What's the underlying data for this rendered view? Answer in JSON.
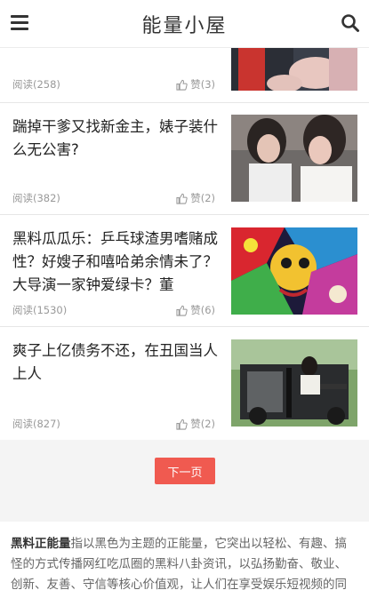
{
  "header": {
    "title": "能量小屋",
    "menu_icon": "hamburger-menu-icon",
    "search_icon": "search-icon"
  },
  "articles": [
    {
      "title": "",
      "reads": "阅读(258)",
      "likes": "赞(3)"
    },
    {
      "title": "踹掉干爹又找新金主，婊子装什么无公害?",
      "reads": "阅读(382)",
      "likes": "赞(2)"
    },
    {
      "title": "黑料瓜瓜乐：乒乓球渣男嗜赌成性？好嫂子和嘻哈弟余情未了？大导演一家钟爱绿卡？董",
      "reads": "阅读(1530)",
      "likes": "赞(6)"
    },
    {
      "title": "爽子上亿债务不还，在丑国当人上人",
      "reads": "阅读(827)",
      "likes": "赞(2)"
    }
  ],
  "pager": {
    "next_label": "下一页"
  },
  "footer": {
    "brand": "黑料正能量",
    "text": "指以黑色为主题的正能量，它突出以轻松、有趣、搞怪的方式传播网红吃瓜圈的黑料八卦资讯，以弘扬勤奋、敬业、创新、友善、守信等核心价值观，让人们在享受娱乐短视频的同"
  },
  "colors": {
    "accent": "#f05a50",
    "meta": "#999999"
  }
}
